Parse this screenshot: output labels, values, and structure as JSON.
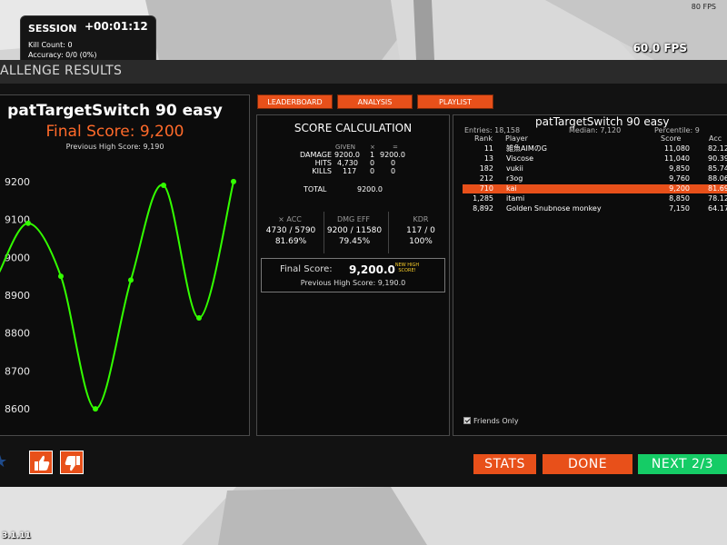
{
  "hud": {
    "fps_small": "80 FPS",
    "fps_big": "60.0 FPS",
    "version": "3.1.11"
  },
  "session": {
    "title": "SESSION",
    "time": "+00:01:12",
    "kill_count": "Kill Count: 0",
    "accuracy": "Accuracy: 0/0 (0%)"
  },
  "window": {
    "title": "ALLENGE RESULTS"
  },
  "summary": {
    "scenario": "patTargetSwitch 90 easy",
    "final_score": "Final Score: 9,200",
    "previous_high": "Previous High Score: 9,190"
  },
  "chart_data": {
    "type": "line",
    "x": [
      1,
      2,
      3,
      4,
      5,
      6,
      7
    ],
    "series": [
      {
        "values": [
          9090,
          8950,
          8600,
          8940,
          9190,
          8840,
          9200
        ]
      }
    ],
    "ylim": [
      8550,
      9250
    ],
    "yticks": [
      8600,
      8700,
      8800,
      8900,
      9000,
      9100,
      9200
    ],
    "xlabel": "",
    "ylabel": "",
    "grid": false,
    "line_color": "#33ff00",
    "title": ""
  },
  "tabs": [
    "LEADERBOARD",
    "ANALYSIS",
    "PLAYLIST"
  ],
  "calc": {
    "title": "SCORE CALCULATION",
    "headers": {
      "given": "GIVEN",
      "mult": "×",
      "eq": "="
    },
    "rows": [
      {
        "label": "DAMAGE",
        "given": "9200.0",
        "mult": "1",
        "result": "9200.0"
      },
      {
        "label": "HITS",
        "given": "4,730",
        "mult": "0",
        "result": "0"
      },
      {
        "label": "KILLS",
        "given": "117",
        "mult": "0",
        "result": "0"
      }
    ],
    "total_label": "TOTAL",
    "total_value": "9200.0",
    "stats": [
      {
        "header": "× ACC",
        "value": "4730 / 5790",
        "pct": "81.69%"
      },
      {
        "header": "DMG EFF",
        "value": "9200 / 11580",
        "pct": "79.45%"
      },
      {
        "header": "KDR",
        "value": "117 / 0",
        "pct": "100%"
      }
    ],
    "final_label": "Final Score:",
    "final_value": "9,200.0",
    "new_high": "NEW HIGH SCORE!",
    "previous": "Previous High Score: 9,190.0"
  },
  "leaderboard": {
    "title": "patTargetSwitch 90 easy",
    "entries": "Entries: 18,158",
    "median": "Median: 7,120",
    "percentile": "Percentile: 9",
    "columns": {
      "rank": "Rank",
      "player": "Player",
      "score": "Score",
      "acc": "Acc"
    },
    "rows": [
      {
        "rank": "11",
        "player": "雑魚AIMのG",
        "score": "11,080",
        "acc": "82.12"
      },
      {
        "rank": "13",
        "player": "Viscose",
        "score": "11,040",
        "acc": "90.39"
      },
      {
        "rank": "182",
        "player": "vukii",
        "score": "9,850",
        "acc": "85.74"
      },
      {
        "rank": "212",
        "player": "r3og",
        "score": "9,760",
        "acc": "88.06"
      },
      {
        "rank": "710",
        "player": "kai",
        "score": "9,200",
        "acc": "81.69"
      },
      {
        "rank": "1,285",
        "player": "itami",
        "score": "8,850",
        "acc": "78.12"
      },
      {
        "rank": "8,892",
        "player": "Golden Snubnose monkey",
        "score": "7,150",
        "acc": "64.17"
      }
    ],
    "highlight_index": 4,
    "friends_only": "Friends Only"
  },
  "buttons": {
    "stats": "STATS",
    "done": "DONE",
    "next": "NEXT 2/3"
  },
  "colors": {
    "accent": "#e8501a",
    "score": "#ff6a2a",
    "next": "#15cc66"
  }
}
